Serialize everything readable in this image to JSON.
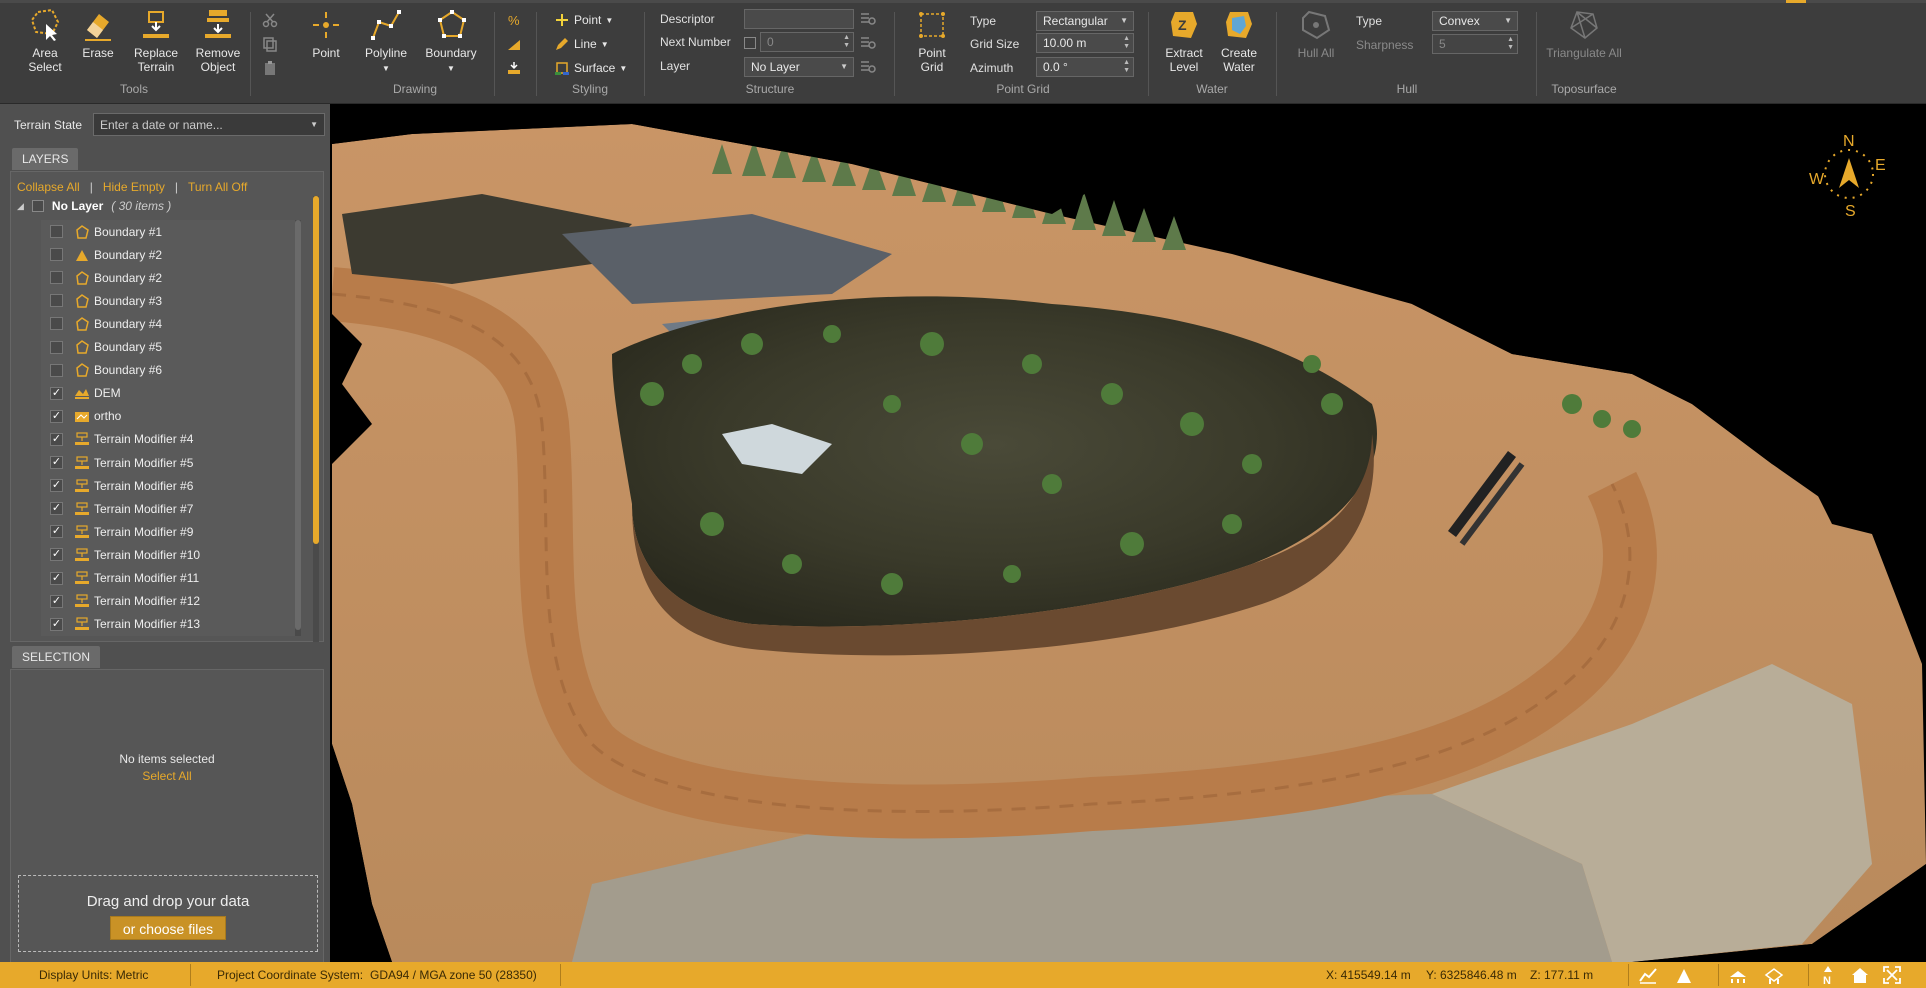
{
  "ribbon": {
    "tools": {
      "label": "Tools",
      "area_select": "Area Select",
      "erase": "Erase",
      "replace_terrain": "Replace Terrain",
      "remove_object": "Remove Object"
    },
    "drawing": {
      "label": "Drawing",
      "point": "Point",
      "polyline": "Polyline",
      "boundary": "Boundary"
    },
    "styling": {
      "label": "Styling",
      "point": "Point",
      "line": "Line",
      "surface": "Surface"
    },
    "structure": {
      "label": "Structure",
      "descriptor_label": "Descriptor",
      "descriptor_value": "",
      "next_number_label": "Next Number",
      "next_number_value": "0",
      "layer_label": "Layer",
      "layer_value": "No Layer"
    },
    "point_grid": {
      "label": "Point Grid",
      "button": "Point Grid",
      "type_label": "Type",
      "type_value": "Rectangular",
      "grid_size_label": "Grid Size",
      "grid_size_value": "10.00 m",
      "azimuth_label": "Azimuth",
      "azimuth_value": "0.0 °"
    },
    "water": {
      "label": "Water",
      "extract_level": "Extract Level",
      "create_water": "Create Water"
    },
    "hull": {
      "label": "Hull",
      "hull_all": "Hull All",
      "type_label": "Type",
      "type_value": "Convex",
      "sharpness_label": "Sharpness",
      "sharpness_value": "5"
    },
    "toposurface": {
      "label": "Toposurface",
      "triangulate_all": "Triangulate All"
    }
  },
  "left_panel": {
    "terrain_state_label": "Terrain State",
    "terrain_state_placeholder": "Enter a date or name...",
    "layers_tab": "LAYERS",
    "collapse_all": "Collapse All",
    "hide_empty": "Hide Empty",
    "turn_all_off": "Turn All Off",
    "separator": "|",
    "group_name": "No Layer",
    "group_count": "( 30 items )",
    "items": [
      {
        "label": "Boundary #1",
        "checked": false,
        "icon": "boundary"
      },
      {
        "label": "Boundary #2",
        "checked": false,
        "icon": "triangle"
      },
      {
        "label": "Boundary #2",
        "checked": false,
        "icon": "boundary"
      },
      {
        "label": "Boundary #3",
        "checked": false,
        "icon": "boundary"
      },
      {
        "label": "Boundary #4",
        "checked": false,
        "icon": "boundary"
      },
      {
        "label": "Boundary #5",
        "checked": false,
        "icon": "boundary"
      },
      {
        "label": "Boundary #6",
        "checked": false,
        "icon": "boundary"
      },
      {
        "label": "DEM",
        "checked": true,
        "icon": "dem"
      },
      {
        "label": "ortho",
        "checked": true,
        "icon": "ortho"
      },
      {
        "label": "Terrain Modifier #4",
        "checked": true,
        "icon": "modifier"
      },
      {
        "label": "Terrain Modifier #5",
        "checked": true,
        "icon": "modifier"
      },
      {
        "label": "Terrain Modifier #6",
        "checked": true,
        "icon": "modifier"
      },
      {
        "label": "Terrain Modifier #7",
        "checked": true,
        "icon": "modifier"
      },
      {
        "label": "Terrain Modifier #9",
        "checked": true,
        "icon": "modifier"
      },
      {
        "label": "Terrain Modifier #10",
        "checked": true,
        "icon": "modifier"
      },
      {
        "label": "Terrain Modifier #11",
        "checked": true,
        "icon": "modifier"
      },
      {
        "label": "Terrain Modifier #12",
        "checked": true,
        "icon": "modifier"
      },
      {
        "label": "Terrain Modifier #13",
        "checked": true,
        "icon": "modifier"
      }
    ],
    "selection_tab": "SELECTION",
    "no_items": "No items selected",
    "select_all": "Select All",
    "drop_text": "Drag and drop your data",
    "choose_files": "or choose files"
  },
  "compass": {
    "n": "N",
    "e": "E",
    "s": "S",
    "w": "W"
  },
  "status_bar": {
    "display_units": "Display Units: Metric",
    "project_cs_label": "Project Coordinate System:",
    "project_cs_value": "GDA94 / MGA zone 50 (28350)",
    "x": "X: 415549.14 m",
    "y": "Y: 6325846.48 m",
    "z": "Z: 177.11 m"
  },
  "colors": {
    "accent": "#e7a92b",
    "ribbon": "#3d3d3d",
    "panel": "#505050"
  }
}
